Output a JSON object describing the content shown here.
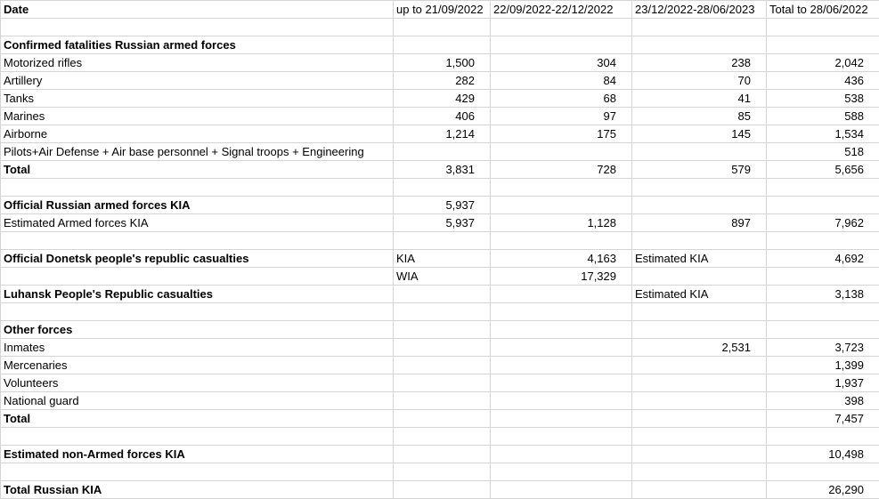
{
  "header": [
    "Date",
    "up to 21/09/2022",
    "22/09/2022-22/12/2022",
    "23/12/2022-28/06/2023",
    "Total to 28/06/2022"
  ],
  "rows": [
    {
      "type": "blank"
    },
    {
      "type": "section",
      "label": "Confirmed fatalities Russian armed forces"
    },
    {
      "type": "data",
      "cells": [
        "Motorized rifles",
        "1,500",
        "304",
        "238",
        "2,042"
      ]
    },
    {
      "type": "data",
      "cells": [
        "Artillery",
        "282",
        "84",
        "70",
        "436"
      ]
    },
    {
      "type": "data",
      "cells": [
        "Tanks",
        "429",
        "68",
        "41",
        "538"
      ]
    },
    {
      "type": "data",
      "cells": [
        "Marines",
        "406",
        "97",
        "85",
        "588"
      ]
    },
    {
      "type": "data",
      "cells": [
        "Airborne",
        "1,214",
        "175",
        "145",
        "1,534"
      ]
    },
    {
      "type": "data",
      "cells": [
        "Pilots+Air Defense + Air base personnel + Signal troops + Engineering",
        "",
        "",
        "",
        "518"
      ]
    },
    {
      "type": "total",
      "cells": [
        "Total",
        "3,831",
        "728",
        "579",
        "5,656"
      ]
    },
    {
      "type": "blank"
    },
    {
      "type": "section-data",
      "cells": [
        "Official Russian armed forces KIA",
        "5,937",
        "",
        "",
        ""
      ]
    },
    {
      "type": "data",
      "cells": [
        "Estimated Armed forces KIA",
        "5,937",
        "1,128",
        "897",
        "7,962"
      ]
    },
    {
      "type": "blank"
    },
    {
      "type": "mixed",
      "cells": [
        "Official Donetsk people's republic casualties",
        "KIA",
        "4,163",
        "Estimated KIA",
        "4,692"
      ]
    },
    {
      "type": "mixed",
      "cells": [
        "",
        "WIA",
        "17,329",
        "",
        ""
      ]
    },
    {
      "type": "mixed",
      "cells": [
        "Luhansk People's Republic casualties",
        "",
        "",
        "Estimated KIA",
        "3,138"
      ]
    },
    {
      "type": "blank"
    },
    {
      "type": "section",
      "label": "Other forces"
    },
    {
      "type": "data",
      "cells": [
        "Inmates",
        "",
        "",
        "2,531",
        "3,723"
      ]
    },
    {
      "type": "data",
      "cells": [
        "Mercenaries",
        "",
        "",
        "",
        "1,399"
      ]
    },
    {
      "type": "data",
      "cells": [
        "Volunteers",
        "",
        "",
        "",
        "1,937"
      ]
    },
    {
      "type": "data",
      "cells": [
        "National guard",
        "",
        "",
        "",
        "398"
      ]
    },
    {
      "type": "total",
      "cells": [
        "Total",
        "",
        "",
        "",
        "7,457"
      ]
    },
    {
      "type": "blank"
    },
    {
      "type": "total",
      "cells": [
        "Estimated non-Armed forces KIA",
        "",
        "",
        "",
        "10,498"
      ]
    },
    {
      "type": "blank"
    },
    {
      "type": "total",
      "cells": [
        "Total Russian KIA",
        "",
        "",
        "",
        "26,290"
      ]
    }
  ]
}
